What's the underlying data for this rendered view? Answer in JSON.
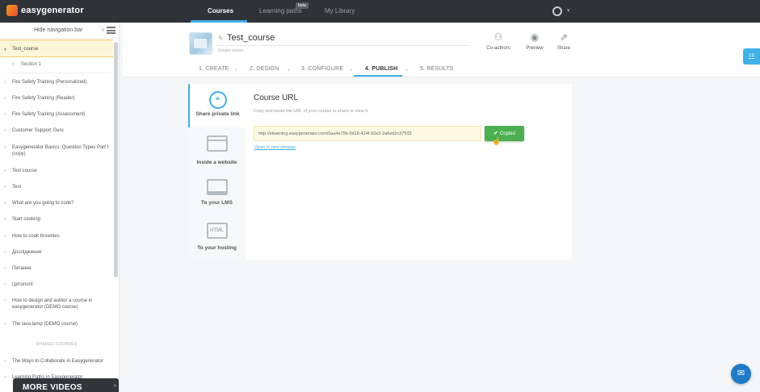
{
  "brand": "easygenerator",
  "nav": {
    "tabs": [
      "Courses",
      "Learning paths",
      "My Library"
    ],
    "beta_badge": "beta",
    "active_tab": "Courses"
  },
  "sidebar": {
    "toggle_label": "Hide navigation bar",
    "active_course": "Test_course",
    "section": "Section 1",
    "courses": [
      "Fire Safety Training (Personalized)",
      "Fire Safety Training (Reader)",
      "Fire Safety Training (Assessment)",
      "Customer Support Guru",
      "Easygenerator Basics: Question Types Part I (copy)",
      "Test course",
      "Test",
      "What are you going to cook?",
      "Start cooking",
      "How to cook brownies",
      "Дослідження",
      "Питання",
      "Цитології",
      "How to design and author a course in easygenerator (DEMO course)",
      "The lava lamp (DEMO course)"
    ],
    "shared_label": "SHARED COURSES",
    "shared_courses": [
      "The Ways to Collaborate in Easygenerator",
      "Learning Paths in Easygenerator"
    ]
  },
  "more_videos": "MORE VIDEOS",
  "course": {
    "title": "Test_course",
    "type": "Simple course"
  },
  "toolbar": {
    "coauthors": "Co-authors",
    "preview": "Preview",
    "share": "Share"
  },
  "steps": [
    "1. CREATE",
    "2. DESIGN",
    "3. CONFIGURE",
    "4. PUBLISH",
    "5. RESULTS"
  ],
  "active_step": "4. PUBLISH",
  "publish_options": [
    {
      "label": "Share private link",
      "icon": "link-icon",
      "active": true
    },
    {
      "label": "Inside a website",
      "icon": "website-icon",
      "active": false
    },
    {
      "label": "To your LMS",
      "icon": "monitor-icon",
      "active": false
    },
    {
      "label": "To your hosting",
      "icon": "html-file-icon",
      "active": false
    }
  ],
  "html_glyph": "HTML",
  "course_url": {
    "title": "Course URL",
    "description": "Copy and paste the URL of your course to share or view it.",
    "url": "http://elearning.easygenerator.com/0aa4e75b-0d18-414f-92e3-2a6ed2c37933",
    "copied_label": "Copied",
    "open_link": "Open in new window"
  },
  "colors": {
    "accent": "#3fb0e8",
    "topbar": "#2f3237",
    "copied": "#4caf50",
    "url_bg": "#fdf9e2",
    "active_course_bg": "#fdf6d8"
  }
}
